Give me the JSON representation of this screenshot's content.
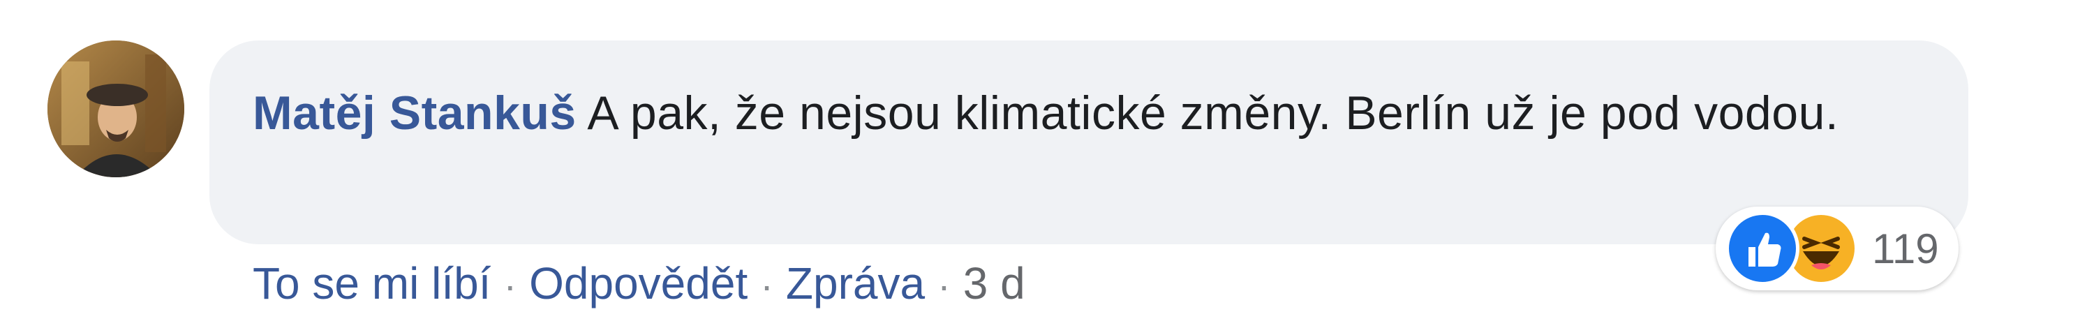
{
  "comment": {
    "author": "Matěj Stankuš",
    "text": " A pak, že nejsou klimatické změny. Berlín už je pod vodou.",
    "avatar_icon": "profile-photo-man-in-cap",
    "bubble_color": "#f0f2f5",
    "author_color": "#385898"
  },
  "actions": {
    "like_label": "To se mi líbí",
    "reply_label": "Odpovědět",
    "message_label": "Zpráva",
    "separator": "·",
    "timestamp": "3 d"
  },
  "reactions": {
    "icons": [
      "like-icon",
      "haha-icon"
    ],
    "count": "119",
    "like_color": "#1877f2",
    "haha_color": "#f7b125"
  }
}
